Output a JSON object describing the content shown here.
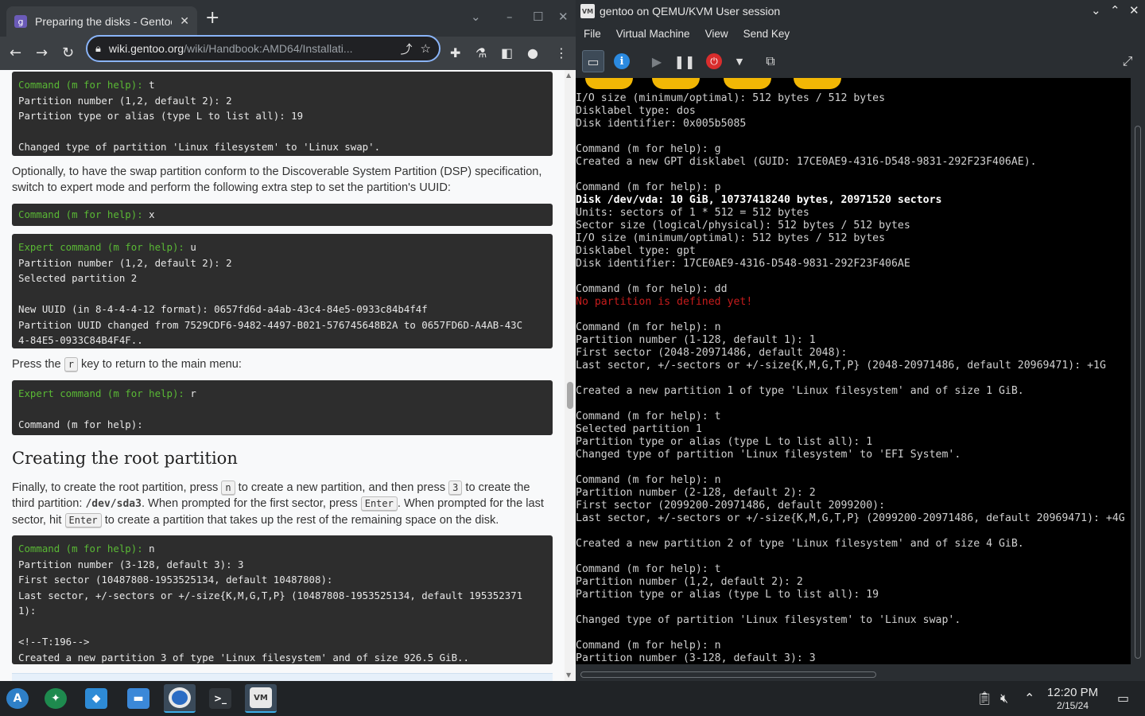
{
  "browser": {
    "tab_title": "Preparing the disks - Gentoo",
    "tab_favicon": "gentoo-favicon",
    "url_host": "wiki.gentoo.org",
    "url_path": "/wiki/Handbook:AMD64/Installati...",
    "new_tab": "+",
    "close": "✕"
  },
  "page": {
    "code1": {
      "prompt": "Command (m for help):",
      "cmd": " t",
      "body": "Partition number (1,2, default 2): 2\nPartition type or alias (type L to list all): 19\n\nChanged type of partition 'Linux filesystem' to 'Linux swap'."
    },
    "para1": "Optionally, to have the swap partition conform to the Discoverable System Partition (DSP) specification, switch to expert mode and perform the following extra step to set the partition's UUID:",
    "code2": {
      "prompt": "Command (m for help):",
      "cmd": " x"
    },
    "code3": {
      "prompt": "Expert command (m for help):",
      "cmd": " u",
      "body": "Partition number (1,2, default 2): 2\nSelected partition 2\n\nNew UUID (in 8-4-4-4-12 format): 0657fd6d-a4ab-43c4-84e5-0933c84b4f4f\nPartition UUID changed from 7529CDF6-9482-4497-B021-576745648B2A to 0657FD6D-A4AB-43C\n4-84E5-0933C84B4F4F.."
    },
    "para2_pre": "Press the ",
    "para2_key": "r",
    "para2_post": " key to return to the main menu:",
    "code4": {
      "prompt": "Expert command (m for help):",
      "cmd": " r",
      "body": "\nCommand (m for help):"
    },
    "heading": "Creating the root partition",
    "para3": {
      "t1": "Finally, to create the root partition, press ",
      "k1": "n",
      "t2": " to create a new partition, and then press ",
      "k2": "3",
      "t3": " to create the third partition: ",
      "dev": "/dev/sda3",
      "t4": ". When prompted for the first sector, press ",
      "k3": "Enter",
      "t5": ". When prompted for the last sector, hit ",
      "k4": "Enter",
      "t6": " to create a partition that takes up the rest of the remaining space on the disk."
    },
    "code5": {
      "prompt": "Command (m for help):",
      "cmd": " n",
      "body": "Partition number (3-128, default 3): 3\nFirst sector (10487808-1953525134, default 10487808):\nLast sector, +/-sectors or +/-size{K,M,G,T,P} (10487808-1953525134, default 195352371\n1):\n\n<!--T:196-->\nCreated a new partition 3 of type 'Linux filesystem' and of size 926.5 GiB.."
    }
  },
  "vm": {
    "title": "gentoo on QEMU/KVM User session",
    "menu": [
      "File",
      "Virtual Machine",
      "View",
      "Send Key"
    ],
    "console_lines": {
      "a": "I/O size (minimum/optimal): 512 bytes / 512 bytes\nDisklabel type: dos\nDisk identifier: 0x005b5085\n\nCommand (m for help): g\nCreated a new GPT disklabel (GUID: 17CE0AE9-4316-D548-9831-292F23F406AE).\n\nCommand (m for help): p",
      "b": "Disk /dev/vda: 10 GiB, 10737418240 bytes, 20971520 sectors",
      "c": "Units: sectors of 1 * 512 = 512 bytes\nSector size (logical/physical): 512 bytes / 512 bytes\nI/O size (minimum/optimal): 512 bytes / 512 bytes\nDisklabel type: gpt\nDisk identifier: 17CE0AE9-4316-D548-9831-292F23F406AE\n\nCommand (m for help): dd",
      "d": "No partition is defined yet!",
      "e": "\nCommand (m for help): n\nPartition number (1-128, default 1): 1\nFirst sector (2048-20971486, default 2048):\nLast sector, +/-sectors or +/-size{K,M,G,T,P} (2048-20971486, default 20969471): +1G\n\nCreated a new partition 1 of type 'Linux filesystem' and of size 1 GiB.\n\nCommand (m for help): t\nSelected partition 1\nPartition type or alias (type L to list all): 1\nChanged type of partition 'Linux filesystem' to 'EFI System'.\n\nCommand (m for help): n\nPartition number (2-128, default 2): 2\nFirst sector (2099200-20971486, default 2099200):\nLast sector, +/-sectors or +/-size{K,M,G,T,P} (2099200-20971486, default 20969471): +4G\n\nCreated a new partition 2 of type 'Linux filesystem' and of size 4 GiB.\n\nCommand (m for help): t\nPartition number (1,2, default 2): 2\nPartition type or alias (type L to list all): 19\n\nChanged type of partition 'Linux filesystem' to 'Linux swap'.\n\nCommand (m for help): n\nPartition number (3-128, default 3): 3"
    }
  },
  "taskbar": {
    "clock_time": "12:20 PM",
    "clock_date": "2/15/24"
  },
  "colors": {
    "prompt_green": "#5ab935",
    "error_red": "#c61c1c",
    "accent_blue": "#8ab4f8"
  }
}
